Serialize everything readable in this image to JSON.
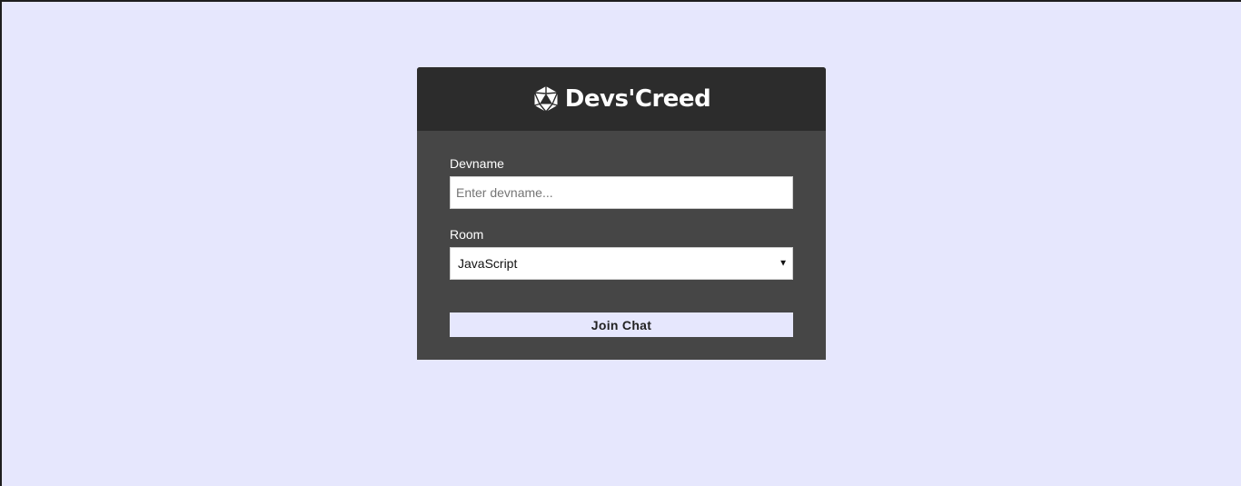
{
  "brand": {
    "title": "Devs'Creed",
    "icon": "d20-dice-icon"
  },
  "form": {
    "devname": {
      "label": "Devname",
      "placeholder": "Enter devname...",
      "value": ""
    },
    "room": {
      "label": "Room",
      "selected": "JavaScript"
    },
    "submit_label": "Join Chat"
  },
  "colors": {
    "background": "#e6e7fd",
    "header": "#2c2c2c",
    "card": "#464646",
    "button": "#e6e7fd"
  }
}
